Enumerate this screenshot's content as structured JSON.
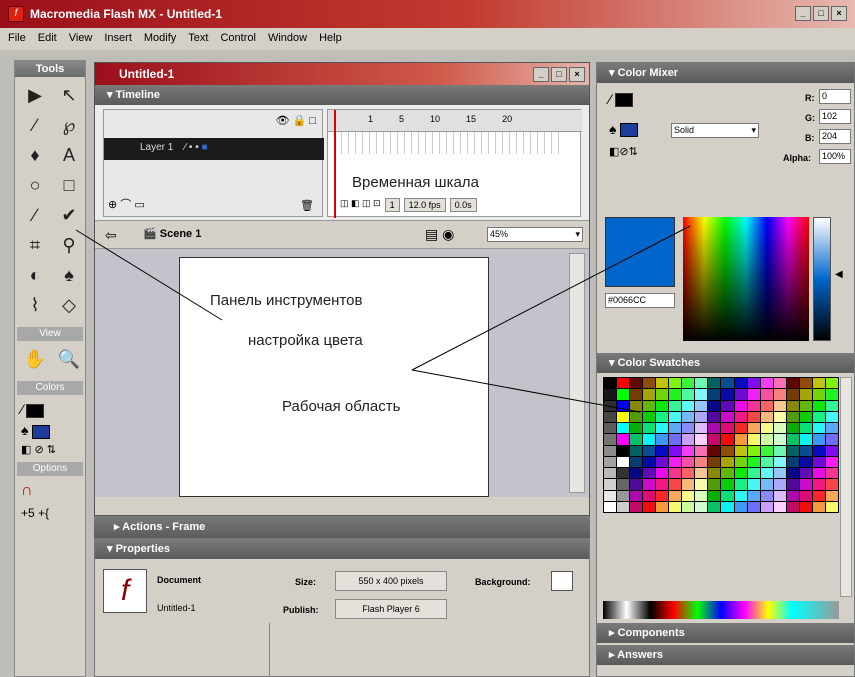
{
  "app": {
    "title": "Macromedia Flash MX - Untitled-1",
    "icon_letter": "f"
  },
  "menu": [
    "File",
    "Edit",
    "View",
    "Insert",
    "Modify",
    "Text",
    "Control",
    "Window",
    "Help"
  ],
  "tools": {
    "title": "Tools",
    "grid": [
      "▶",
      "↖",
      "∕",
      "℘",
      "♦",
      "A",
      "○",
      "□",
      "∕",
      "✔",
      "⌗",
      "⚲",
      "◐",
      "♠",
      "⌇",
      "◇"
    ],
    "view_label": "View",
    "view_tools": [
      "✋",
      "🔍"
    ],
    "colors_label": "Colors",
    "options_label": "Options"
  },
  "document": {
    "title": "Untitled-1",
    "timeline_label": "Timeline",
    "layer_name": "Layer 1",
    "ruler": [
      "1",
      "5",
      "10",
      "15",
      "20"
    ],
    "frame_num": "1",
    "fps": "12.0 fps",
    "time": "0.0s",
    "scene": "Scene 1",
    "zoom": "45%"
  },
  "panels": {
    "actions": "Actions - Frame",
    "properties": "Properties",
    "doc_label": "Document",
    "doc_name": "Untitled-1",
    "size_label": "Size:",
    "size_value": "550 x 400 pixels",
    "background_label": "Background:",
    "publish_label": "Publish:",
    "publish_value": "Flash Player 6"
  },
  "mixer": {
    "title": "Color Mixer",
    "fill": "Solid",
    "r_label": "R:",
    "r_value": "0",
    "g_label": "G:",
    "g_value": "102",
    "b_label": "B:",
    "b_value": "204",
    "alpha_label": "Alpha:",
    "alpha_value": "100%",
    "hex": "#0066CC",
    "accent_color": "#0066cc"
  },
  "swatches": {
    "title": "Color Swatches"
  },
  "bottom_panels": [
    "Components",
    "Answers"
  ],
  "annotations": {
    "timeline": "Временная шкала",
    "tools_panel": "Панель инструментов",
    "color_setup": "настройка цвета",
    "workspace": "Рабочая область"
  }
}
